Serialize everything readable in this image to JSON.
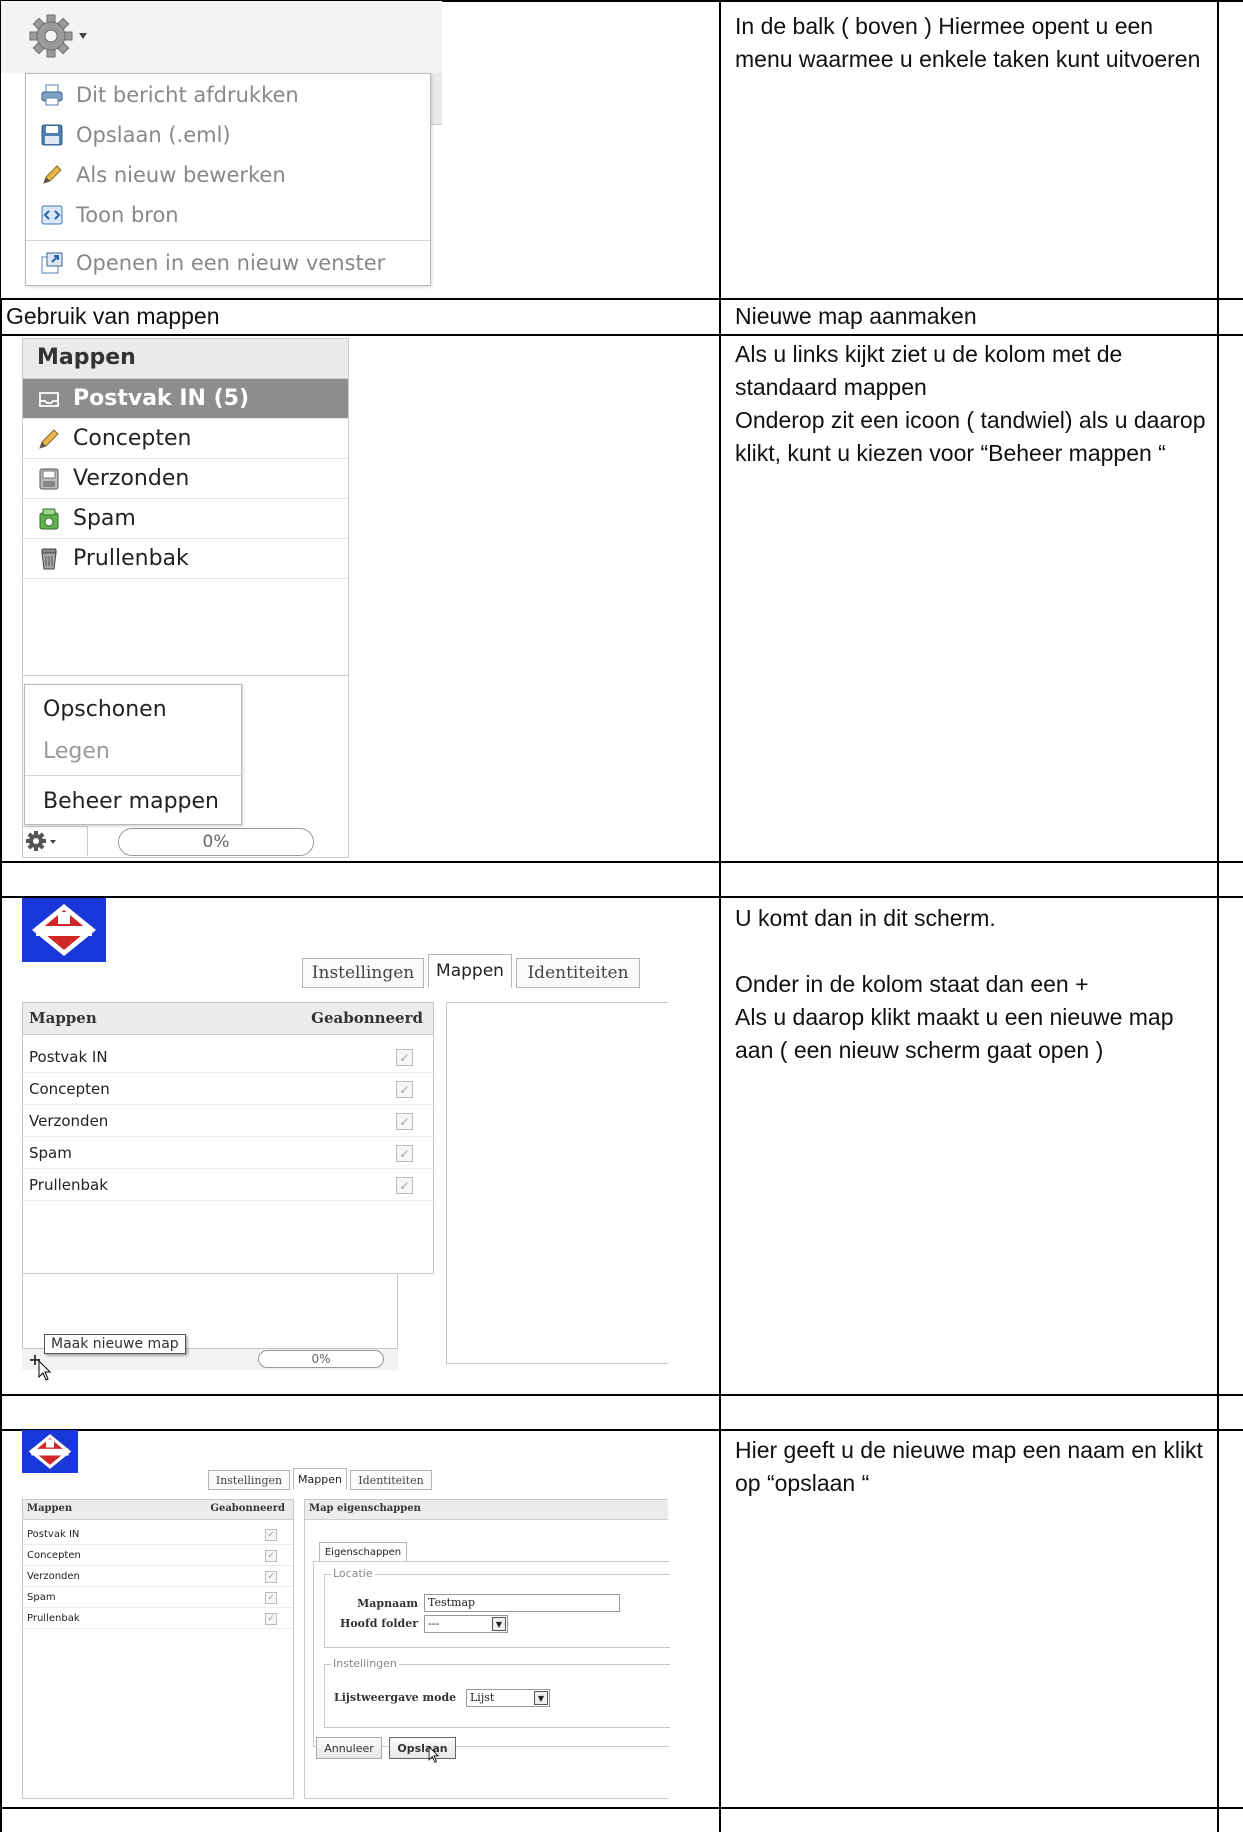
{
  "rows": [
    {
      "right_text": "In de balk ( boven ) Hiermee opent u een menu waarmee u enkele taken kunt uitvoeren"
    },
    {
      "left_text": "Gebruik van mappen",
      "right_text": "Nieuwe map aanmaken"
    },
    {
      "right_text": "Als u links kijkt ziet u de kolom met de standaard mappen\nOnderop zit een icoon ( tandwiel) als u daarop klikt, kunt u kiezen voor “Beheer mappen “"
    },
    {
      "right_text": "U komt dan in dit scherm.\n\nOnder in de kolom staat dan een +\nAls u daarop klikt maakt u een nieuwe map aan ( een nieuw scherm gaat open )"
    },
    {
      "right_text": "Hier geeft u de nieuwe map een naam en klikt op “opslaan “"
    }
  ],
  "message_menu": {
    "items": [
      {
        "label": "Dit bericht afdrukken",
        "icon": "printer-icon"
      },
      {
        "label": "Opslaan (.eml)",
        "icon": "floppy-icon"
      },
      {
        "label": "Als nieuw bewerken",
        "icon": "pencil-icon"
      },
      {
        "label": "Toon bron",
        "icon": "source-icon"
      },
      {
        "label": "Openen in een nieuw venster",
        "icon": "new-window-icon"
      }
    ]
  },
  "folders_panel": {
    "title": "Mappen",
    "folders": [
      {
        "label": "Postvak IN (5)",
        "icon": "inbox-icon",
        "selected": true
      },
      {
        "label": "Concepten",
        "icon": "pencil-icon"
      },
      {
        "label": "Verzonden",
        "icon": "sent-icon"
      },
      {
        "label": "Spam",
        "icon": "spam-icon"
      },
      {
        "label": "Prullenbak",
        "icon": "trash-icon"
      }
    ],
    "context_menu": [
      {
        "label": "Opschonen",
        "enabled": true
      },
      {
        "label": "Legen",
        "enabled": false
      },
      {
        "label": "Beheer mappen",
        "enabled": true
      }
    ],
    "quota": "0%"
  },
  "settings_screen": {
    "tabs": [
      "Instellingen",
      "Mappen",
      "Identiteiten"
    ],
    "active_tab": "Mappen",
    "columns": {
      "name": "Mappen",
      "subscribed": "Geabonneerd"
    },
    "folders": [
      "Postvak IN",
      "Concepten",
      "Verzonden",
      "Spam",
      "Prullenbak"
    ],
    "tooltip": "Maak nieuwe map",
    "quota": "0%"
  },
  "new_folder_screen": {
    "tabs": [
      "Instellingen",
      "Mappen",
      "Identiteiten"
    ],
    "columns": {
      "name": "Mappen",
      "subscribed": "Geabonneerd"
    },
    "folders": [
      "Postvak IN",
      "Concepten",
      "Verzonden",
      "Spam",
      "Prullenbak"
    ],
    "properties_title": "Map eigenschappen",
    "properties_tab": "Eigenschappen",
    "location_legend": "Locatie",
    "folder_name_label": "Mapnaam",
    "folder_name_value": "Testmap",
    "parent_label": "Hoofd folder",
    "parent_value": "---",
    "settings_legend": "Instellingen",
    "view_mode_label": "Lijstweergave mode",
    "view_mode_value": "Lijst",
    "cancel_label": "Annuleer",
    "save_label": "Opslaan"
  }
}
